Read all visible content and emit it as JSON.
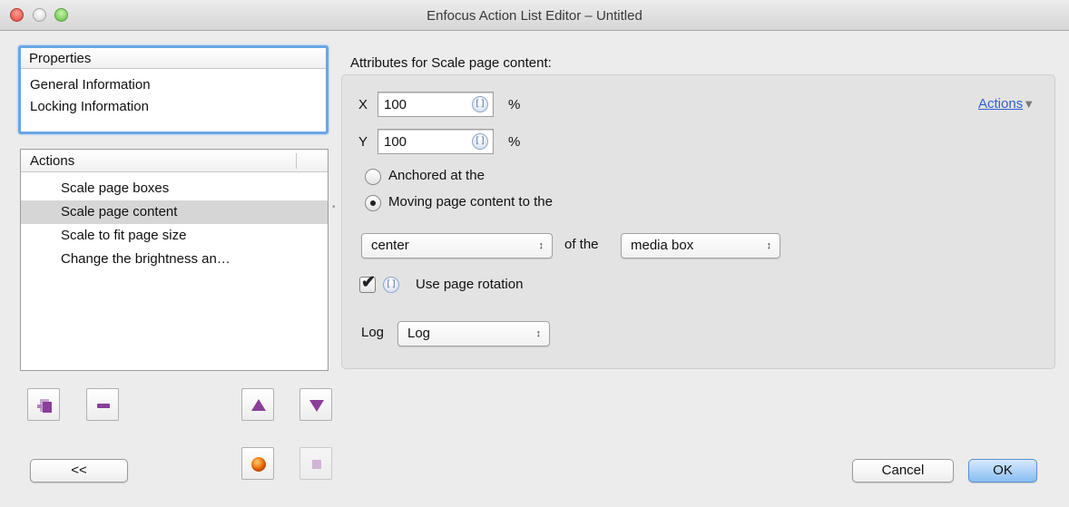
{
  "window": {
    "title": "Enfocus Action List Editor – Untitled"
  },
  "properties": {
    "header": "Properties",
    "items": [
      "General Information",
      "Locking Information"
    ]
  },
  "actions": {
    "header": "Actions",
    "items": [
      {
        "label": "Scale page boxes",
        "selected": false
      },
      {
        "label": "Scale page content",
        "selected": true
      },
      {
        "label": "Scale to fit page size",
        "selected": false
      },
      {
        "label": "Change the brightness an…",
        "selected": false
      }
    ]
  },
  "attributes": {
    "title": "Attributes for Scale page content:",
    "x_label": "X",
    "x_value": "100",
    "y_label": "Y",
    "y_value": "100",
    "unit": "%",
    "variable_icon_glyph": "[]",
    "actions_link": "Actions",
    "actions_link_arrow": "▼",
    "radio_anchored": "Anchored at the",
    "radio_moving": "Moving page content to the",
    "selected_radio": "moving",
    "position_select": "center",
    "of_the": "of the",
    "box_select": "media box",
    "select_arrows": "↕",
    "use_rotation_label": "Use page rotation",
    "use_rotation_checked": true,
    "checkmark": "✔",
    "log_label": "Log",
    "log_select": "Log"
  },
  "buttons": {
    "collapse": "<<",
    "cancel": "Cancel",
    "ok": "OK"
  },
  "colors": {
    "accent": "#6aa6e6",
    "icon_purple": "#8a3f9a",
    "record_orange": "#f07a12",
    "link": "#2f5fd3"
  },
  "icons": {
    "add": "add-action-icon",
    "remove": "remove-action-icon",
    "up": "move-up-icon",
    "down": "move-down-icon",
    "record": "record-icon",
    "stop": "stop-icon"
  }
}
